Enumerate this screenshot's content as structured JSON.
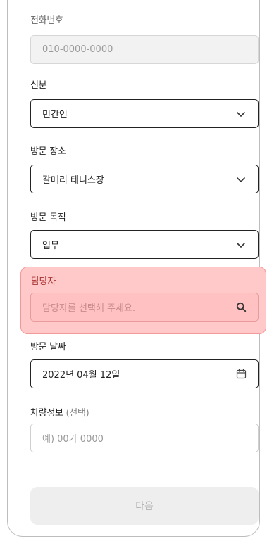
{
  "form": {
    "phone": {
      "label": "전화번호",
      "value": "010-0000-0000"
    },
    "status": {
      "label": "신분",
      "value": "민간인"
    },
    "place": {
      "label": "방문 장소",
      "value": "갈매리 테니스장"
    },
    "purpose": {
      "label": "방문 목적",
      "value": "업무"
    },
    "manager": {
      "label": "담당자",
      "placeholder": "담당자를 선택해 주세요."
    },
    "date": {
      "label": "방문 날짜",
      "value": "2022년 04월 12일"
    },
    "vehicle": {
      "label": "차량정보",
      "label_suffix": "(선택)",
      "placeholder": "예) 00가 0000"
    }
  },
  "next_button": {
    "label": "다음"
  },
  "icons": {
    "select": "chevron-down-icon",
    "search": "search-icon",
    "date": "calendar-icon"
  },
  "colors": {
    "highlight_bg": "#ffc9c9",
    "highlight_border": "#f29a9a",
    "button_bg": "#eeeeee"
  }
}
